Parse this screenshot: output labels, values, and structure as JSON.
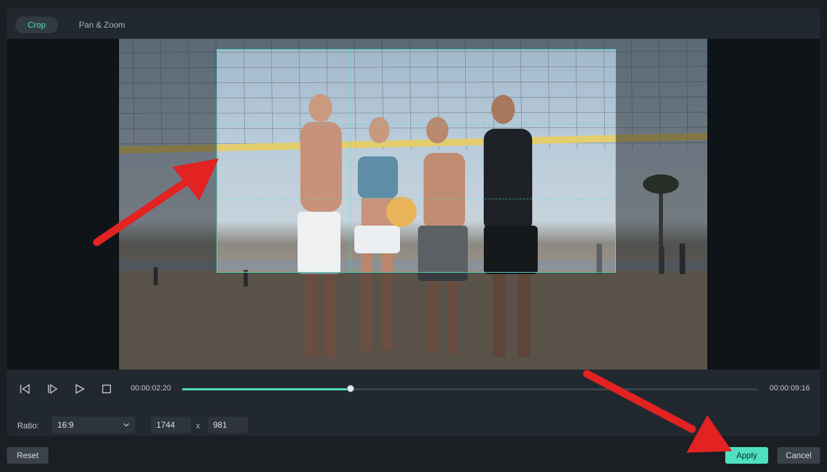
{
  "tabs": [
    {
      "label": "Crop",
      "active": true
    },
    {
      "label": "Pan & Zoom",
      "active": false
    }
  ],
  "playback": {
    "current_time": "00:00:02:20",
    "total_time": "00:00:09:16",
    "progress": 0.292
  },
  "crop": {
    "ratio_label": "Ratio:",
    "ratio_value": "16:9",
    "width": "1744",
    "separator": "x",
    "height": "981"
  },
  "footer": {
    "reset_label": "Reset",
    "apply_label": "Apply",
    "cancel_label": "Cancel"
  },
  "colors": {
    "accent": "#4fe0bf",
    "annotation": "#e32222"
  },
  "icons": [
    "prev-frame-icon",
    "next-frame-icon",
    "play-icon",
    "stop-icon",
    "chevron-down-icon"
  ]
}
